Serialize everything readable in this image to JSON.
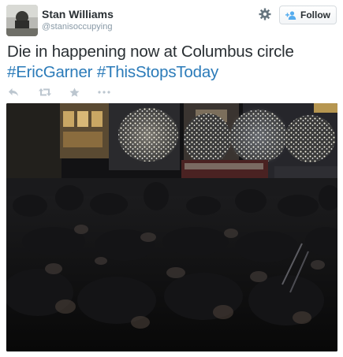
{
  "user": {
    "name": "Stan Williams",
    "handle": "@stanisoccupying"
  },
  "tweet": {
    "text_line1": "Die in happening now at Columbus circle",
    "hashtag1": "#EricGarner",
    "hashtag2": "#ThisStopsToday"
  },
  "follow": {
    "label": "Follow"
  },
  "icons": {
    "settings": "gear-icon",
    "follow": "add-user-icon",
    "reply": "reply-icon",
    "retweet": "retweet-icon",
    "favorite": "star-icon",
    "more": "more-icon"
  },
  "colors": {
    "link": "#2b7bb9",
    "text": "#292f33",
    "muted": "#8899a6",
    "action_icon": "#bcc6cf"
  }
}
